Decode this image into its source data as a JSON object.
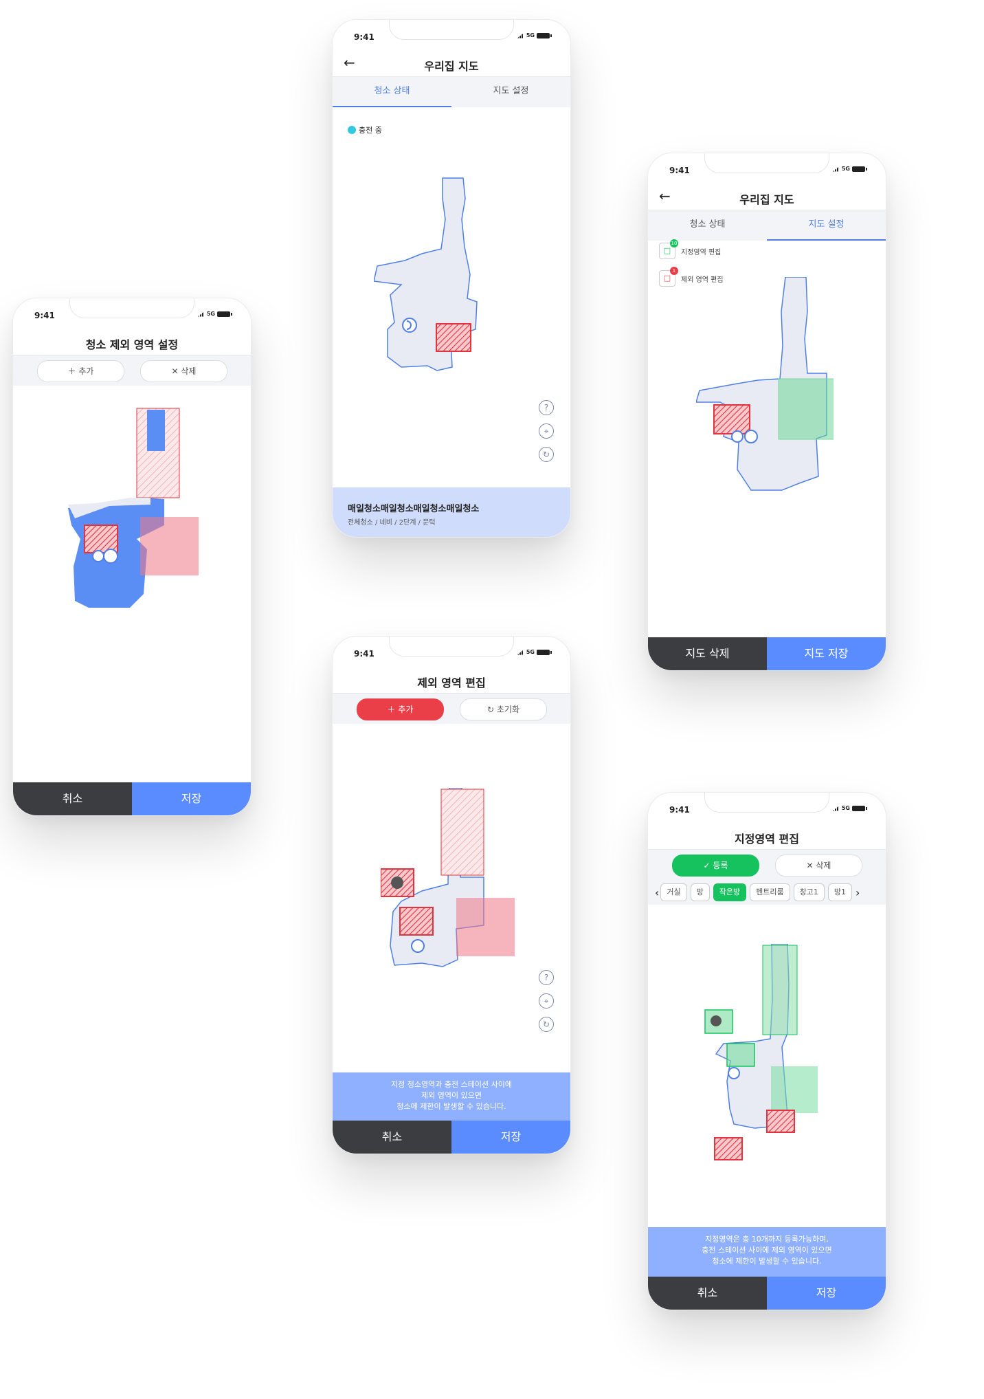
{
  "status": {
    "time": "9:41",
    "network": "5G"
  },
  "map_status": {
    "title": "우리집 지도",
    "tabs": [
      "청소 상태",
      "지도 설정"
    ],
    "legend": "충전 중",
    "schedule_title": "매일청소매일청소매일청소매일청소",
    "schedule_detail": "전체청소 / 네비 / 2단계 / 문턱"
  },
  "map_settings": {
    "title": "우리집 지도",
    "tabs": [
      "청소 상태",
      "지도 설정"
    ],
    "zone_edit": "지정영역 편집",
    "zone_count": "10",
    "exclude_edit": "제외 영역 편집",
    "exclude_count": "1",
    "delete_map": "지도 삭제",
    "save_map": "지도 저장"
  },
  "no_clean": {
    "title": "청소 제외 영역 설정",
    "add": "추가",
    "delete": "삭제",
    "cancel": "취소",
    "save": "저장"
  },
  "exclude_edit": {
    "title": "제외 영역 편집",
    "add": "추가",
    "reset": "초기화",
    "notice": [
      "지정 청소영역과 충전 스테이션 사이에",
      "제외 영역이 있으면",
      "청소에 제한이 발생할 수 있습니다."
    ],
    "cancel": "취소",
    "save": "저장"
  },
  "zone_edit": {
    "title": "지정영역 편집",
    "register": "등록",
    "delete": "삭제",
    "rooms": [
      "거실",
      "방",
      "작은방",
      "펜트리룸",
      "창고1",
      "방1"
    ],
    "selected_room": "작은방",
    "notice": [
      "지정영역은 총 10개까지 등록가능하며,",
      "충전 스테이션 사이에 제외 영역이 있으면",
      "청소에 제한이 발생할 수 있습니다."
    ],
    "cancel": "취소",
    "save": "저장"
  },
  "colors": {
    "accent": "#5a8cff",
    "danger": "#ea3f48",
    "zone": "#16c25e",
    "map_fill": "#e8ebf3",
    "map_line": "#4f7fe6"
  }
}
